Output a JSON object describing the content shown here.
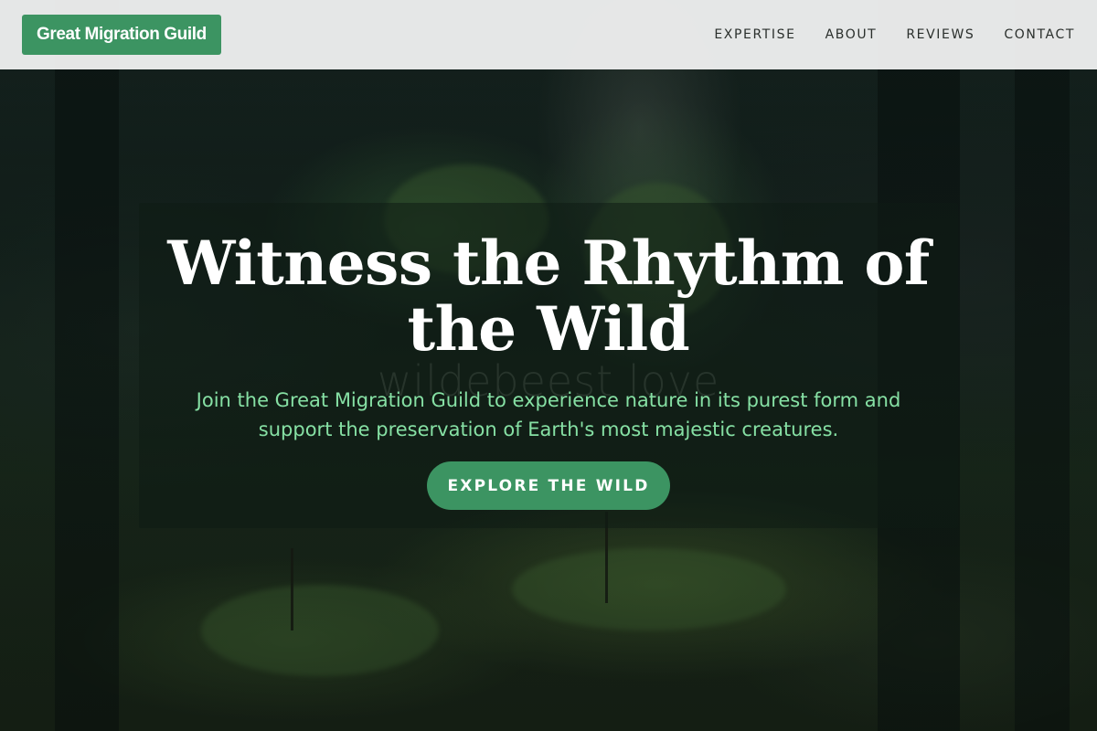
{
  "header": {
    "brand": "Great Migration Guild",
    "nav": [
      "EXPERTISE",
      "ABOUT",
      "REVIEWS",
      "CONTACT"
    ]
  },
  "hero": {
    "title": "Witness the Rhythm of the Wild",
    "watermark": "wildebeest love",
    "subtitle": "Join the Great Migration Guild to experience nature in its purest form and support the preservation of Earth's most majestic creatures.",
    "cta": "EXPLORE THE WILD"
  },
  "colors": {
    "accent": "#3c9462",
    "subtitle": "#86e0a4",
    "header_bg": "#eeefef"
  }
}
